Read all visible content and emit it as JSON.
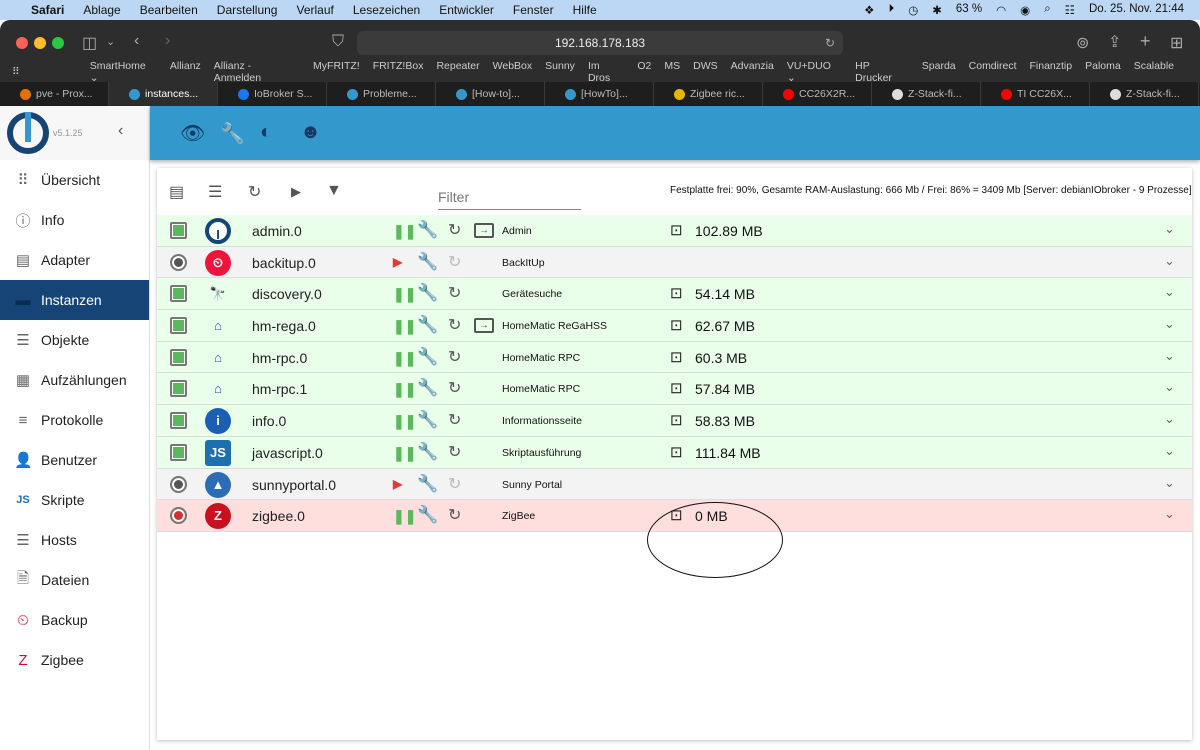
{
  "menubar": {
    "app": "Safari",
    "items": [
      "Ablage",
      "Bearbeiten",
      "Darstellung",
      "Verlauf",
      "Lesezeichen",
      "Entwickler",
      "Fenster",
      "Hilfe"
    ],
    "battery": "63 %",
    "datetime": "Do. 25. Nov.  21:44"
  },
  "browser": {
    "url": "192.168.178.183",
    "bookmarks": [
      "SmartHome ⌄",
      "Allianz",
      "Allianz - Anmelden",
      "MyFRITZ!",
      "FRITZ!Box",
      "Repeater",
      "WebBox",
      "Sunny",
      "Im Dros",
      "O2",
      "MS",
      "DWS",
      "Advanzia",
      "VU+DUO ⌄",
      "HP Drucker",
      "Sparda",
      "Comdirect",
      "Finanztip",
      "Paloma",
      "Scalable"
    ],
    "tabs": [
      {
        "label": "pve - Prox...",
        "icon": "proxmox-icon",
        "color": "#e57000"
      },
      {
        "label": "instances...",
        "icon": "iobroker-icon",
        "color": "#3399cc",
        "active": true
      },
      {
        "label": "IoBroker S...",
        "icon": "facebook-icon",
        "color": "#1877f2"
      },
      {
        "label": "Probleme...",
        "icon": "iobroker-icon",
        "color": "#3399cc"
      },
      {
        "label": "[How-to]...",
        "icon": "iobroker-icon",
        "color": "#3399cc"
      },
      {
        "label": "[HowTo]...",
        "icon": "iobroker-icon",
        "color": "#3399cc"
      },
      {
        "label": "Zigbee ric...",
        "icon": "zigbee-site-icon",
        "color": "#e5b800"
      },
      {
        "label": "CC26X2R...",
        "icon": "youtube-icon",
        "color": "#ff0000"
      },
      {
        "label": "Z-Stack-fi...",
        "icon": "github-icon",
        "color": "#ddd"
      },
      {
        "label": "TI CC26X...",
        "icon": "youtube-icon",
        "color": "#ff0000"
      },
      {
        "label": "Z-Stack-fi...",
        "icon": "github-icon",
        "color": "#ddd"
      }
    ]
  },
  "sidebar": {
    "version": "v5.1.25",
    "items": [
      {
        "label": "Übersicht",
        "icon": "⠿"
      },
      {
        "label": "Info",
        "icon": "ⓘ"
      },
      {
        "label": "Adapter",
        "icon": "▤"
      },
      {
        "label": "Instanzen",
        "icon": "▬",
        "active": true
      },
      {
        "label": "Objekte",
        "icon": "☰"
      },
      {
        "label": "Aufzählungen",
        "icon": "▦"
      },
      {
        "label": "Protokolle",
        "icon": "≡"
      },
      {
        "label": "Benutzer",
        "icon": "👤"
      },
      {
        "label": "Skripte",
        "icon": "JS"
      },
      {
        "label": "Hosts",
        "icon": "☰"
      },
      {
        "label": "Dateien",
        "icon": "🗎"
      },
      {
        "label": "Backup",
        "icon": "⏲"
      },
      {
        "label": "Zigbee",
        "icon": "Z"
      }
    ]
  },
  "instances": {
    "filter_placeholder": "Filter",
    "sysinfo": "Festplatte frei: 90%, Gesamte RAM-Auslastung: 666 Mb / Frei: 86% = 3409 Mb [Server: debianIObroker - 9 Prozesse]",
    "status_colors": {
      "running": "#eaffea",
      "stopped": "#f3f3f3",
      "error": "#ffdede"
    },
    "rows": [
      {
        "name": "admin.0",
        "title": "Admin",
        "memory": "102.89 MB",
        "state": "running",
        "link": true,
        "icon": "I",
        "icon_bg": "#fff",
        "icon_fg": "#164477"
      },
      {
        "name": "backitup.0",
        "title": "BackItUp",
        "memory": "",
        "state": "stopped",
        "link": false,
        "icon": "⏲",
        "icon_bg": "#f0143c",
        "icon_fg": "#fff"
      },
      {
        "name": "discovery.0",
        "title": "Gerätesuche",
        "memory": "54.14 MB",
        "state": "running",
        "link": false,
        "icon": "🔭",
        "icon_bg": "transparent",
        "icon_fg": "#222"
      },
      {
        "name": "hm-rega.0",
        "title": "HomeMatic ReGaHSS",
        "memory": "62.67 MB",
        "state": "running",
        "link": true,
        "icon": "⌂",
        "icon_bg": "transparent",
        "icon_fg": "#3a3aa0"
      },
      {
        "name": "hm-rpc.0",
        "title": "HomeMatic RPC",
        "memory": "60.3 MB",
        "state": "running",
        "link": false,
        "icon": "⌂",
        "icon_bg": "transparent",
        "icon_fg": "#3a3aa0"
      },
      {
        "name": "hm-rpc.1",
        "title": "HomeMatic RPC",
        "memory": "57.84 MB",
        "state": "running",
        "link": false,
        "icon": "⌂",
        "icon_bg": "transparent",
        "icon_fg": "#3a3aa0"
      },
      {
        "name": "info.0",
        "title": "Informationsseite",
        "memory": "58.83 MB",
        "state": "running",
        "link": false,
        "icon": "i",
        "icon_bg": "#1a5fb4",
        "icon_fg": "#fff"
      },
      {
        "name": "javascript.0",
        "title": "Skriptausführung",
        "memory": "111.84 MB",
        "state": "running",
        "link": false,
        "icon": "JS",
        "icon_bg": "#1e6fb0",
        "icon_fg": "#fff"
      },
      {
        "name": "sunnyportal.0",
        "title": "Sunny Portal",
        "memory": "",
        "state": "stopped",
        "link": false,
        "icon": "▲",
        "icon_bg": "#2a6db5",
        "icon_fg": "#fff"
      },
      {
        "name": "zigbee.0",
        "title": "ZigBee",
        "memory": "0 MB",
        "state": "error",
        "link": false,
        "icon": "Z",
        "icon_bg": "#c8101e",
        "icon_fg": "#fff"
      }
    ]
  }
}
